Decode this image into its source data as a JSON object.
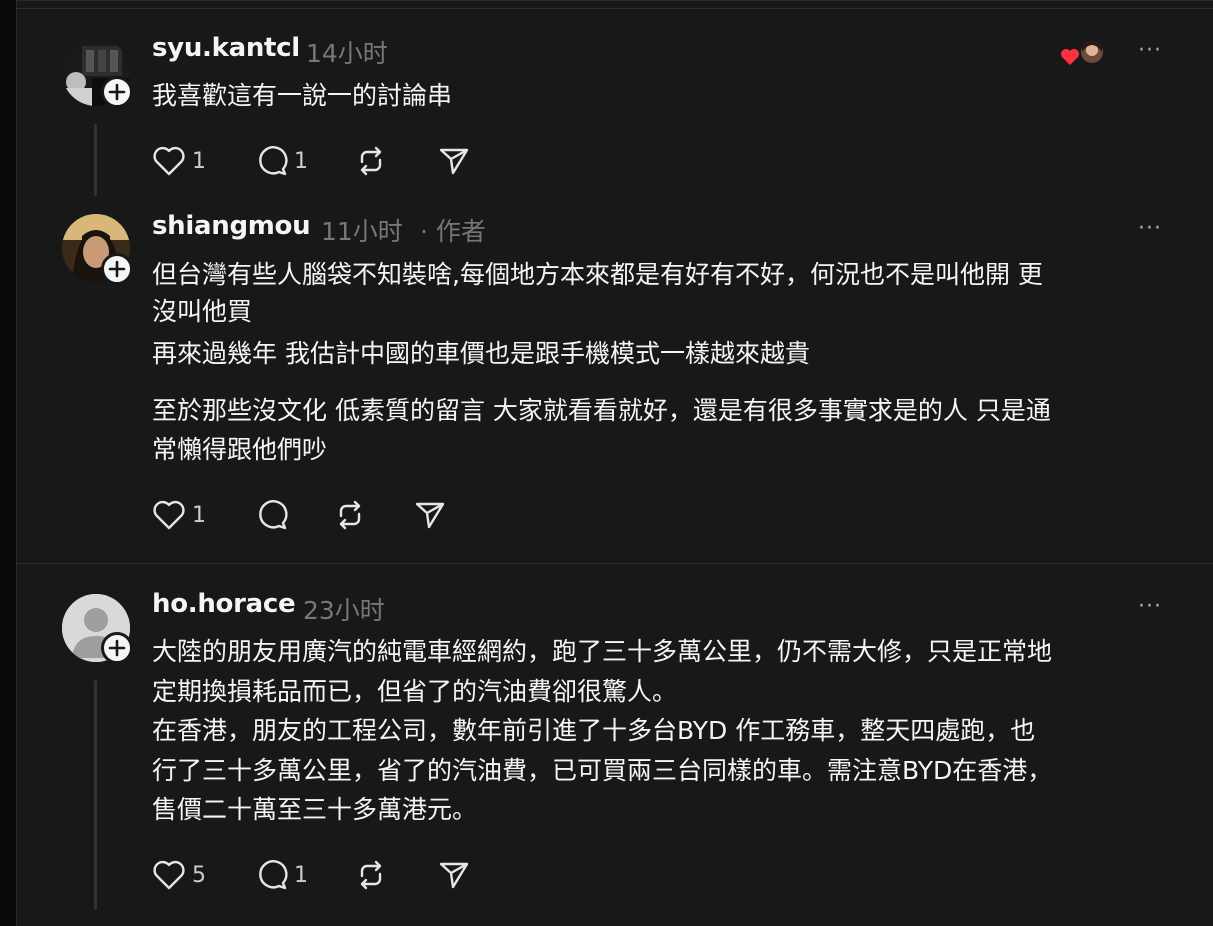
{
  "posts": [
    {
      "username": "syu.kantcl",
      "time": "14小时",
      "lines": [
        "我喜歡這有一說一的討論串"
      ],
      "paragraphs": [],
      "likes": "1",
      "replies": "1",
      "reposts": "",
      "more_label": "···"
    },
    {
      "username": "shiangmou",
      "time": "11小时",
      "author_tag": "· 作者",
      "lines": [
        "但台灣有些人腦袋不知裝啥,每個地方本來都是有好有不好，何況也不是叫他開 更",
        "沒叫他買",
        "再來過幾年 我估計中國的車價也是跟手機模式一樣越來越貴"
      ],
      "paragraphs": [
        "至於那些沒文化 低素質的留言 大家就看看就好，還是有很多事實求是的人 只是通",
        "常懶得跟他們吵"
      ],
      "likes": "1",
      "replies": "",
      "reposts": "",
      "more_label": "···"
    },
    {
      "username": "ho.horace",
      "time": "23小时",
      "lines": [
        "大陸的朋友用廣汽的純電車經網約，跑了三十多萬公里，仍不需大修，只是正常地",
        "定期換損耗品而已，但省了的汽油費卻很驚人。",
        "在香港，朋友的工程公司，數年前引進了十多台BYD 作工務車，整天四處跑，也",
        "行了三十多萬公里，省了的汽油費，已可買兩三台同樣的車。需注意BYD在香港，",
        "售價二十萬至三十多萬港元。"
      ],
      "paragraphs": [],
      "likes": "5",
      "replies": "1",
      "reposts": "",
      "more_label": "···"
    }
  ],
  "icons": {
    "like": "heart-icon",
    "reply": "comment-icon",
    "repost": "repost-icon",
    "share": "send-icon",
    "follow": "plus-icon",
    "liked_by": "red-heart-icon"
  },
  "colors": {
    "background": "#181818",
    "text": "#f3f5f7",
    "secondary": "#777777",
    "heart": "#ff3040"
  }
}
